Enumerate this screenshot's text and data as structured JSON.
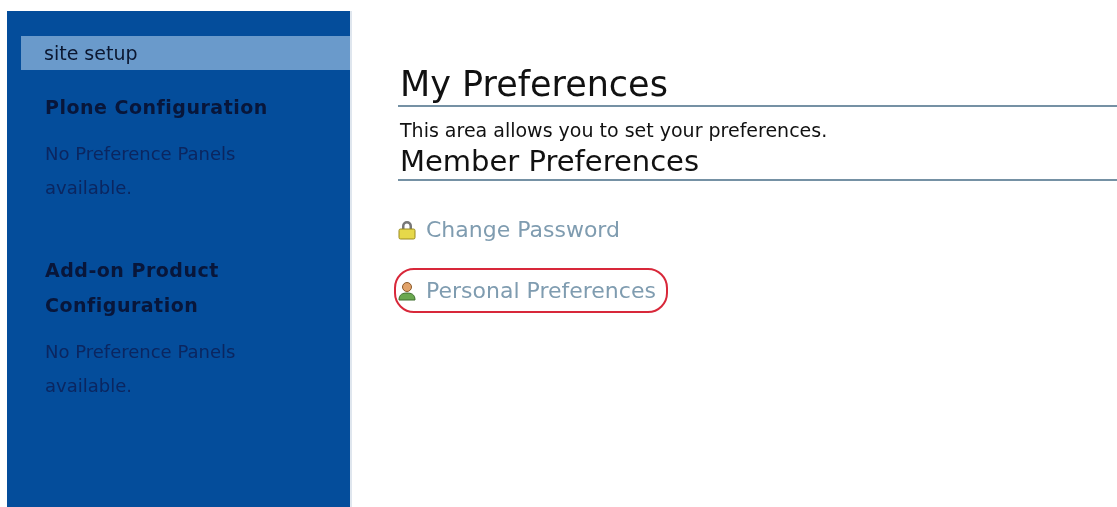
{
  "sidebar": {
    "header": "site setup",
    "sections": [
      {
        "title": "Plone Configuration",
        "message": "No Preference Panels available."
      },
      {
        "title": "Add-on Product Configuration",
        "message": "No Preference Panels available."
      }
    ]
  },
  "main": {
    "title": "My Preferences",
    "description": "This area allows you to set your preferences.",
    "section_title": "Member Preferences",
    "links": [
      {
        "kind": "lock",
        "label": "Change Password",
        "highlighted": false
      },
      {
        "kind": "user",
        "label": "Personal Preferences",
        "highlighted": true
      }
    ]
  }
}
